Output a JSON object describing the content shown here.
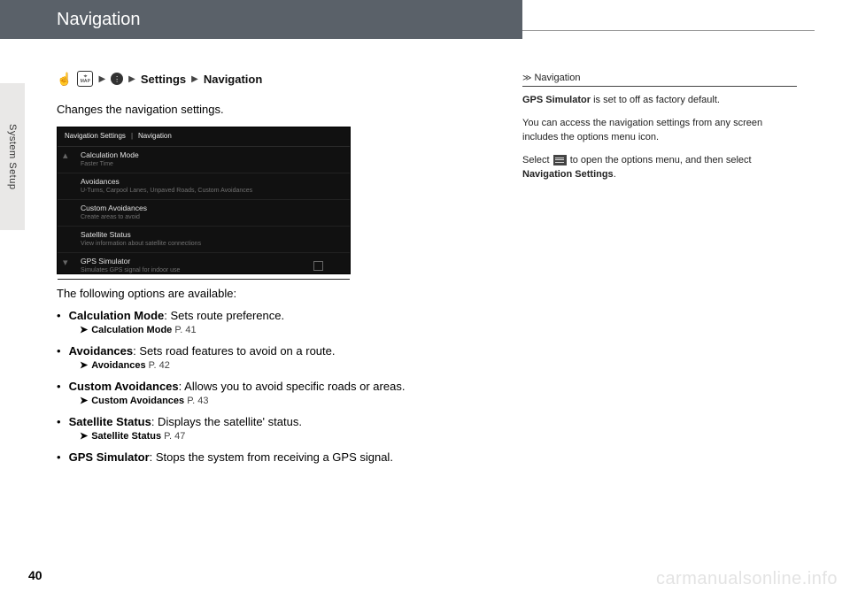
{
  "header": {
    "title": "Navigation"
  },
  "sidebar": {
    "tab_label": "System Setup"
  },
  "breadcrumb": {
    "map_label": "MAP",
    "settings": "Settings",
    "navigation": "Navigation"
  },
  "intro": "Changes the navigation settings.",
  "screenshot": {
    "crumb1": "Navigation Settings",
    "crumb2": "Navigation",
    "rows": [
      {
        "title": "Calculation Mode",
        "sub": "Faster Time"
      },
      {
        "title": "Avoidances",
        "sub": "U-Turns, Carpool Lanes, Unpaved Roads, Custom Avoidances"
      },
      {
        "title": "Custom Avoidances",
        "sub": "Create areas to avoid"
      },
      {
        "title": "Satellite Status",
        "sub": "View information about satellite connections"
      },
      {
        "title": "GPS Simulator",
        "sub": "Simulates GPS signal for indoor use"
      }
    ]
  },
  "options_intro": "The following options are available:",
  "options": [
    {
      "title": "Calculation Mode",
      "desc": ": Sets route preference.",
      "ref": "Calculation Mode",
      "pg": "P. 41"
    },
    {
      "title": "Avoidances",
      "desc": ": Sets road features to avoid on a route.",
      "ref": "Avoidances",
      "pg": "P. 42"
    },
    {
      "title": "Custom Avoidances",
      "desc": ": Allows you to avoid specific roads or areas.",
      "ref": "Custom Avoidances",
      "pg": "P. 43"
    },
    {
      "title": "Satellite Status",
      "desc": ": Displays the satellite' status.",
      "ref": "Satellite Status",
      "pg": "P. 47"
    },
    {
      "title": "GPS Simulator",
      "desc": ": Stops the system from receiving a GPS signal."
    }
  ],
  "aside": {
    "heading": "Navigation",
    "p1_a": "GPS Simulator",
    "p1_b": " is set to off as factory default.",
    "p2": "You can access the navigation settings from any screen includes the options menu icon.",
    "p3_a": "Select ",
    "p3_b": " to open the options menu, and then select ",
    "p3_c": "Navigation Settings",
    "p3_d": "."
  },
  "page_number": "40",
  "watermark": "carmanualsonline.info"
}
